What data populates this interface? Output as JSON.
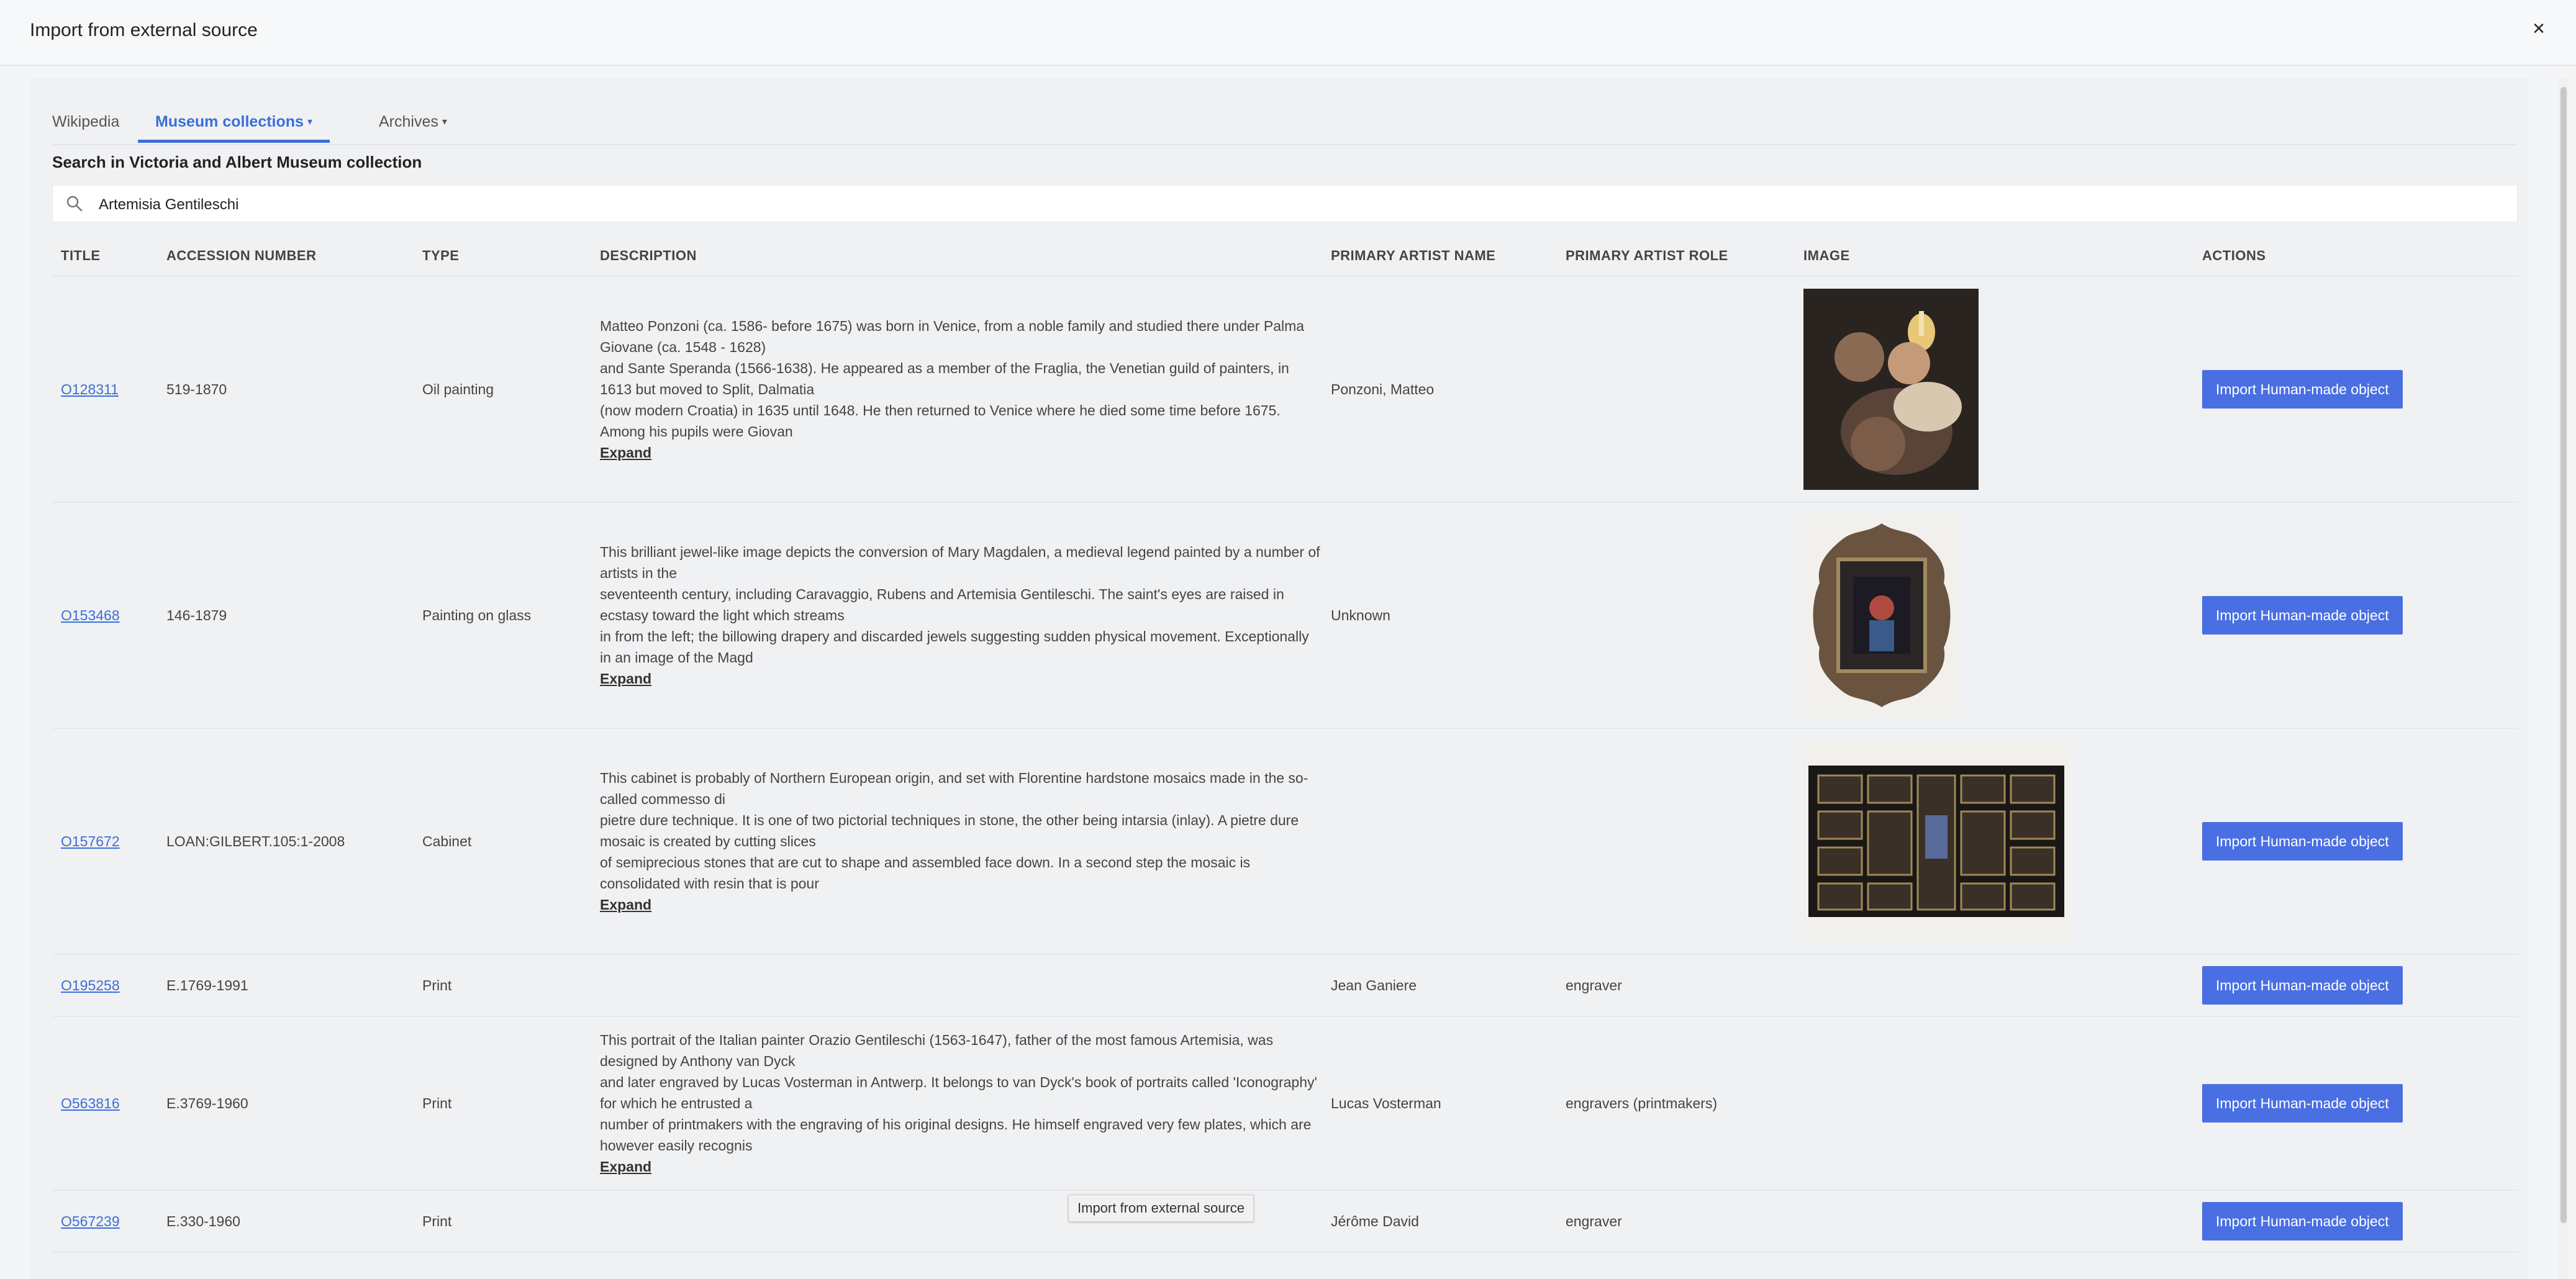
{
  "modal": {
    "title": "Import from external source",
    "close_label": "×"
  },
  "tabs": [
    {
      "label": "Wikipedia",
      "active": false,
      "dropdown": false
    },
    {
      "label": "Museum collections",
      "active": true,
      "dropdown": true
    },
    {
      "label": "Archives",
      "active": false,
      "dropdown": true
    }
  ],
  "tab_caret": "▾",
  "search": {
    "label": "Search in Victoria and Albert Museum collection",
    "value": "Artemisia Gentileschi",
    "icon": "search-icon"
  },
  "table": {
    "headers": [
      "TITLE",
      "ACCESSION NUMBER",
      "TYPE",
      "DESCRIPTION",
      "PRIMARY ARTIST NAME",
      "PRIMARY ARTIST ROLE",
      "IMAGE",
      "ACTIONS"
    ],
    "action_label": "Import Human-made object",
    "expand_label": "Expand",
    "rows": [
      {
        "title": "O128311",
        "accession": "519-1870",
        "type": "Oil painting",
        "description": [
          "Matteo Ponzoni (ca. 1586- before 1675) was born in Venice, from a noble family and studied there under Palma Giovane (ca. 1548 - 1628)",
          "and Sante Speranda (1566-1638). He appeared as a member of the Fraglia, the Venetian guild of painters, in 1613 but moved to Split, Dalmatia",
          "(now modern Croatia) in 1635 until 1648. He then returned to Venice where he died some time before 1675. Among his pupils were Giovan"
        ],
        "artist": "Ponzoni, Matteo",
        "role": "",
        "image": "painting-thumbnail"
      },
      {
        "title": "O153468",
        "accession": "146-1879",
        "type": "Painting on glass",
        "description": [
          "This brilliant jewel-like image depicts the conversion of Mary Magdalen, a medieval legend painted by a number of artists in the",
          "seventeenth century, including Caravaggio, Rubens and Artemisia Gentileschi. The saint's eyes are raised in ecstasy toward the light which streams",
          "in from the left; the billowing drapery and discarded jewels suggesting sudden physical movement. Exceptionally in an image of the Magd"
        ],
        "artist": "Unknown",
        "role": "",
        "image": "framed-glass-thumbnail"
      },
      {
        "title": "O157672",
        "accession": "LOAN:GILBERT.105:1-2008",
        "type": "Cabinet",
        "description": [
          "This cabinet is probably of Northern European origin, and set with Florentine hardstone mosaics made in the so-called commesso di",
          "pietre dure technique. It is one of two pictorial techniques in stone, the other being intarsia (inlay). A pietre dure mosaic is created by cutting slices",
          "of semiprecious stones that are cut to shape and assembled face down. In a second step the mosaic is consolidated with resin that is pour"
        ],
        "artist": "",
        "role": "",
        "image": "cabinet-thumbnail"
      },
      {
        "title": "O195258",
        "accession": "E.1769-1991",
        "type": "Print",
        "description": [],
        "artist": "Jean Ganiere",
        "role": "engraver",
        "image": ""
      },
      {
        "title": "O563816",
        "accession": "E.3769-1960",
        "type": "Print",
        "description": [
          "This portrait of the Italian painter Orazio Gentileschi (1563-1647), father of the most famous Artemisia, was designed by Anthony van Dyck",
          "and later engraved by Lucas Vosterman in Antwerp. It belongs to van Dyck's book of portraits called 'Iconography' for which he entrusted a",
          "number of printmakers with the engraving of his original designs. He himself engraved very few plates, which are however easily recognis"
        ],
        "artist": "Lucas Vosterman",
        "role": "engravers (printmakers)",
        "image": ""
      },
      {
        "title": "O567239",
        "accession": "E.330-1960",
        "type": "Print",
        "description": [],
        "artist": "Jérôme David",
        "role": "engraver",
        "image": ""
      }
    ]
  },
  "tooltip": "Import from external source",
  "colors": {
    "accent": "#3b6fd8",
    "button": "#4a6fe3",
    "panel": "#f0f1f3"
  }
}
